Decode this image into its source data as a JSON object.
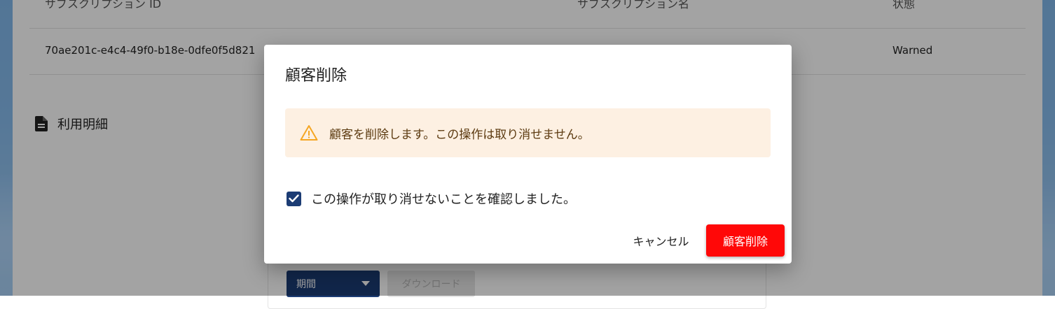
{
  "colors": {
    "primary": "#1c3c74",
    "danger": "#ff0808",
    "warning_bg": "#fdf0e2",
    "warning_icon": "#f5a623"
  },
  "table": {
    "headers": [
      "サブスクリプション ID",
      "サブスクリプション名",
      "状態"
    ],
    "rows": [
      [
        "70ae201c-e4c4-49f0-b18e-0dfe0f5d821",
        "",
        "Warned"
      ]
    ]
  },
  "section": {
    "title": "利用明細",
    "icon": "document-icon"
  },
  "usage": {
    "period_label": "期間",
    "download_label": "ダウンロード"
  },
  "dialog": {
    "title": "顧客削除",
    "warning_icon": "warning-icon",
    "warning_text": "顧客を削除します。この操作は取り消せません。",
    "confirm_label": "この操作が取り消せないことを確認しました。",
    "confirm_checked": true,
    "cancel_label": "キャンセル",
    "delete_label": "顧客削除"
  }
}
